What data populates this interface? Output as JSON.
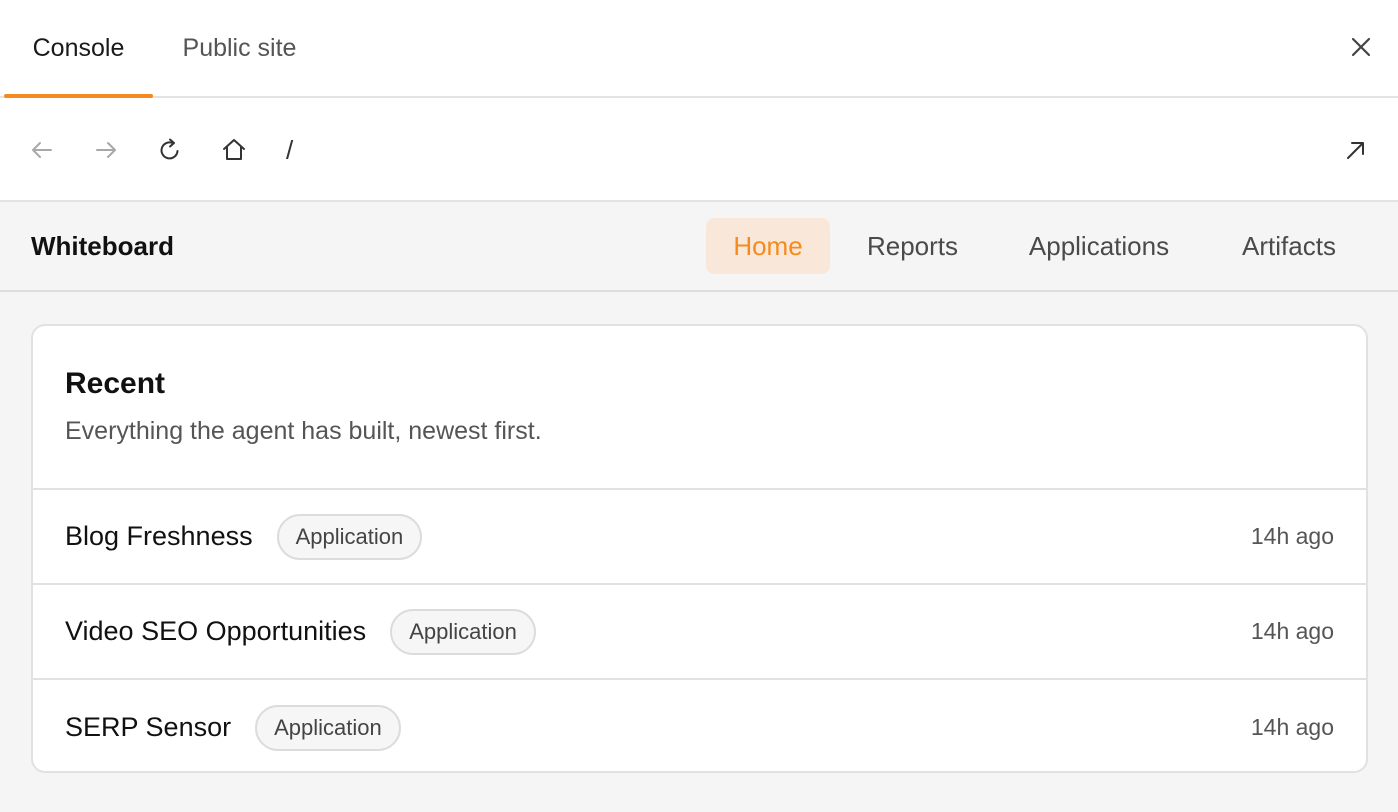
{
  "tabs": [
    {
      "label": "Console",
      "active": true
    },
    {
      "label": "Public site",
      "active": false
    }
  ],
  "toolbar": {
    "path": "/"
  },
  "app": {
    "brand": "Whiteboard",
    "nav": [
      {
        "label": "Home",
        "active": true
      },
      {
        "label": "Reports",
        "active": false
      },
      {
        "label": "Applications",
        "active": false
      },
      {
        "label": "Artifacts",
        "active": false
      }
    ]
  },
  "recent": {
    "title": "Recent",
    "subtitle": "Everything the agent has built, newest first.",
    "items": [
      {
        "name": "Blog Freshness",
        "type": "Application",
        "time": "14h ago"
      },
      {
        "name": "Video SEO Opportunities",
        "type": "Application",
        "time": "14h ago"
      },
      {
        "name": "SERP Sensor",
        "type": "Application",
        "time": "14h ago"
      }
    ]
  },
  "colors": {
    "accent": "#f58a1f",
    "accent_bg": "#f9e8da"
  },
  "icons": {
    "close": "close-icon",
    "back": "arrow-left-icon",
    "forward": "arrow-right-icon",
    "reload": "reload-icon",
    "home": "home-icon",
    "open_external": "arrow-up-right-icon"
  }
}
